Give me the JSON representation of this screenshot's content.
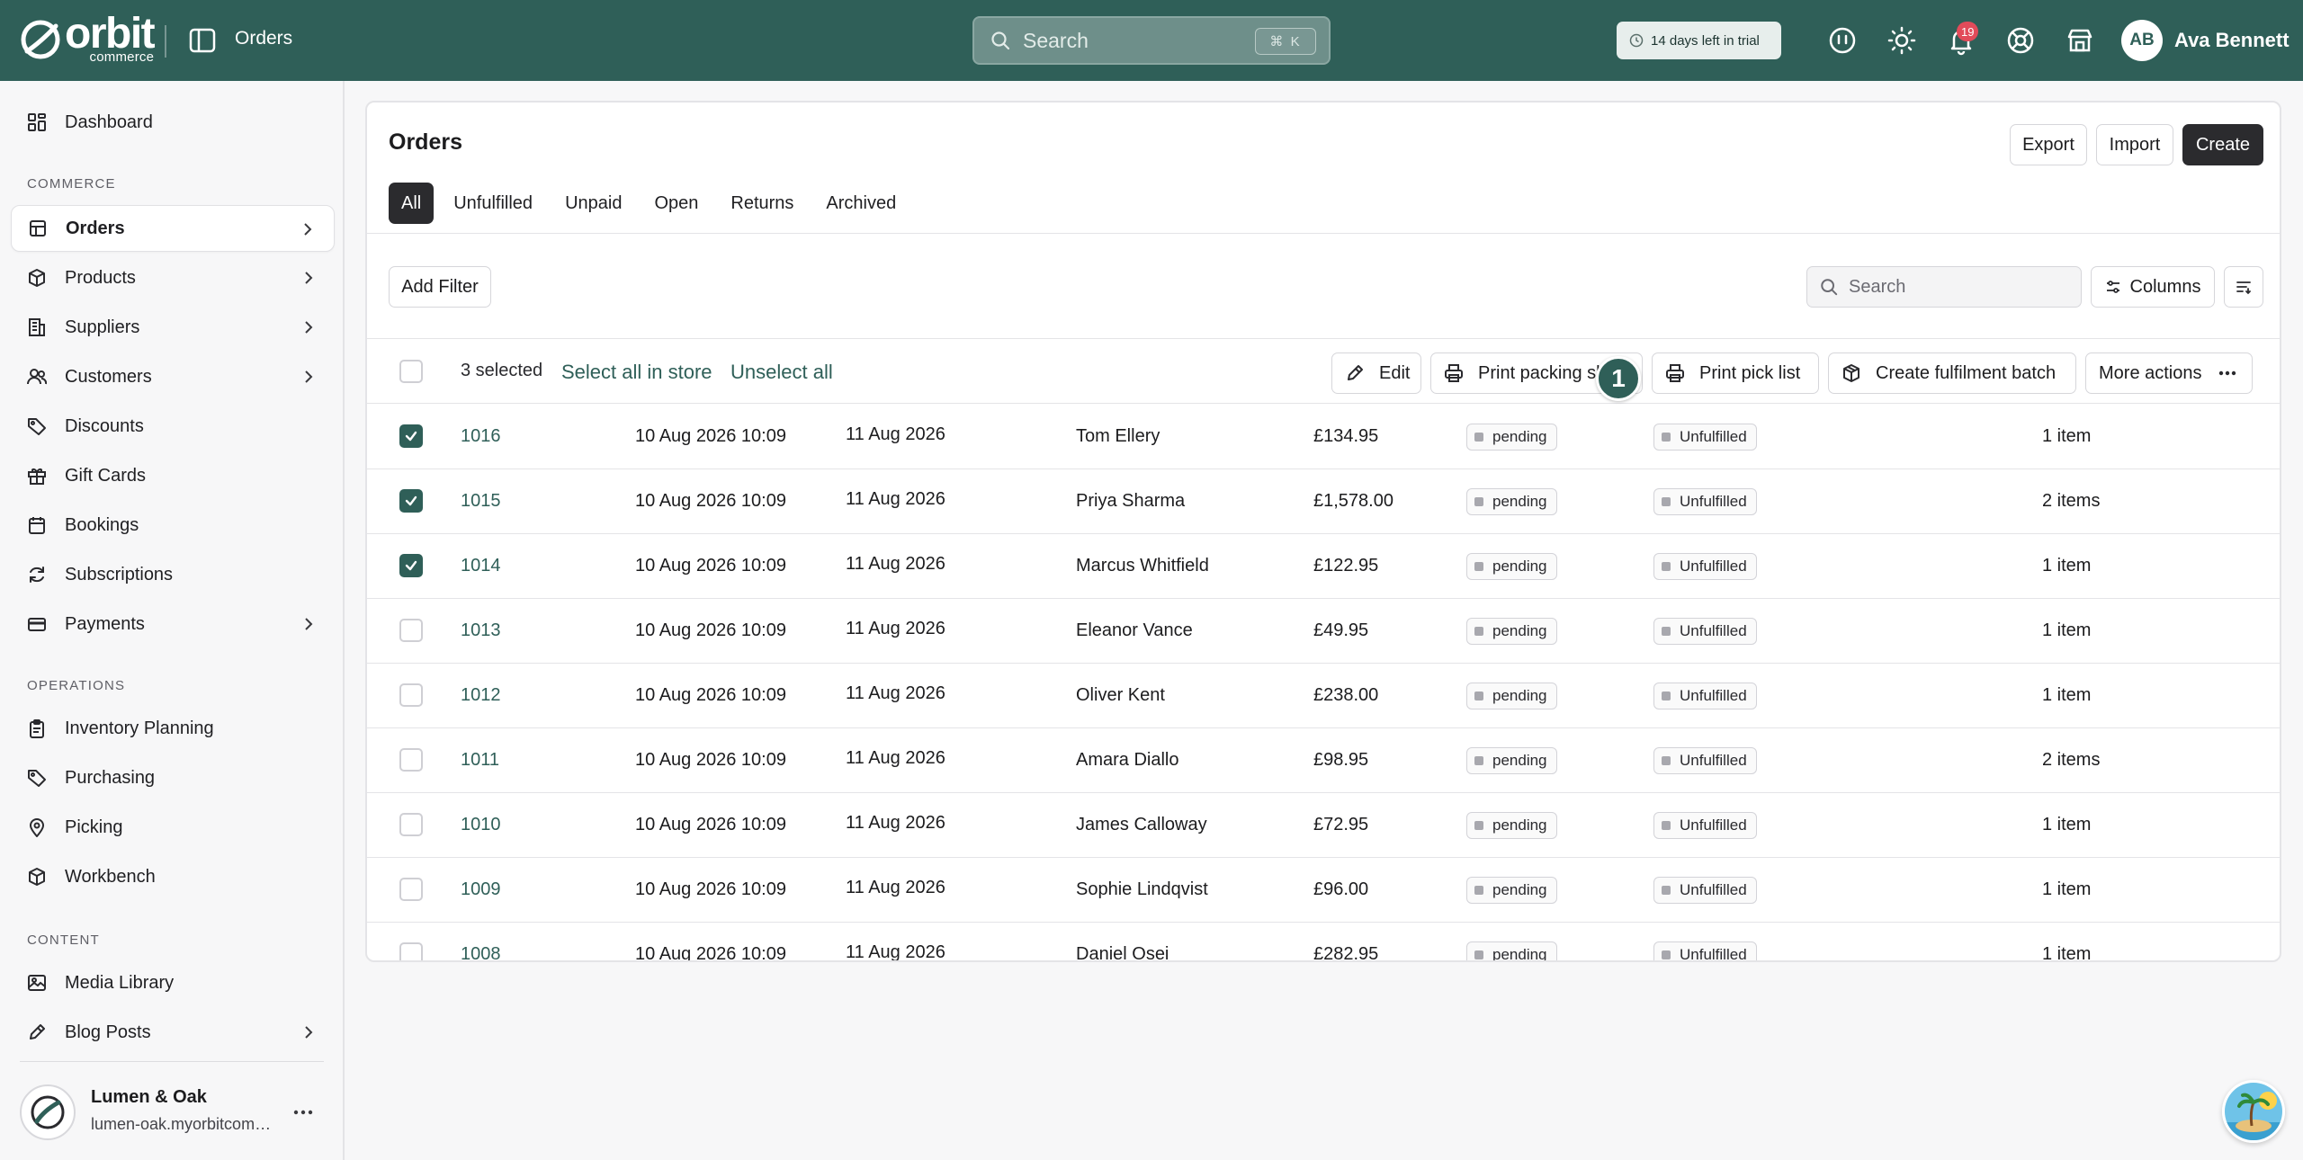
{
  "app": {
    "logo_word": "orbit",
    "logo_sub": "commerce",
    "top_title": "Orders",
    "search_placeholder": "Search",
    "search_shortcut": "⌘ K",
    "trial_text": "14 days left in trial",
    "notification_count": "19",
    "user_initials": "AB",
    "user_name": "Ava Bennett",
    "accent_color": "#2f5f58"
  },
  "sidebar": {
    "dashboard": "Dashboard",
    "commerce_label": "COMMERCE",
    "commerce_items": [
      {
        "label": "Orders",
        "icon": "orders-icon"
      },
      {
        "label": "Products",
        "icon": "box-icon"
      },
      {
        "label": "Suppliers",
        "icon": "building-icon"
      },
      {
        "label": "Customers",
        "icon": "users-icon"
      },
      {
        "label": "Discounts",
        "icon": "tag-icon"
      },
      {
        "label": "Gift Cards",
        "icon": "gift-icon"
      },
      {
        "label": "Bookings",
        "icon": "calendar-icon"
      },
      {
        "label": "Subscriptions",
        "icon": "refresh-icon"
      },
      {
        "label": "Payments",
        "icon": "card-icon"
      }
    ],
    "operations_label": "OPERATIONS",
    "operations_items": [
      {
        "label": "Inventory Planning",
        "icon": "clipboard-icon"
      },
      {
        "label": "Purchasing",
        "icon": "tag-icon"
      },
      {
        "label": "Picking",
        "icon": "pin-icon"
      },
      {
        "label": "Workbench",
        "icon": "box-icon"
      }
    ],
    "content_label": "CONTENT",
    "content_items": [
      {
        "label": "Media Library",
        "icon": "image-icon"
      },
      {
        "label": "Blog Posts",
        "icon": "pen-icon"
      }
    ],
    "store_name": "Lumen & Oak",
    "store_url": "lumen-oak.myorbitcommerce.com"
  },
  "page": {
    "title": "Orders",
    "export": "Export",
    "import": "Import",
    "create": "Create",
    "tabs": [
      "All",
      "Unfulfilled",
      "Unpaid",
      "Open",
      "Returns",
      "Archived"
    ],
    "add_filter": "Add Filter",
    "search_placeholder": "Search",
    "columns": "Columns"
  },
  "bulk": {
    "selected": "3 selected",
    "select_all": "Select all in store",
    "unselect_all": "Unselect all",
    "edit": "Edit",
    "print_packing": "Print packing slips",
    "step": "1",
    "print_pick": "Print pick list",
    "create_batch": "Create fulfilment batch",
    "more_actions": "More actions"
  },
  "orders": [
    {
      "id": "1016",
      "created": "10 Aug 2026 10:09",
      "date": "11 Aug 2026",
      "customer": "Tom Ellery",
      "total": "£134.95",
      "payment": "pending",
      "fulfilment": "Unfulfilled",
      "items": "1 item",
      "checked": true
    },
    {
      "id": "1015",
      "created": "10 Aug 2026 10:09",
      "date": "11 Aug 2026",
      "customer": "Priya Sharma",
      "total": "£1,578.00",
      "payment": "pending",
      "fulfilment": "Unfulfilled",
      "items": "2 items",
      "checked": true
    },
    {
      "id": "1014",
      "created": "10 Aug 2026 10:09",
      "date": "11 Aug 2026",
      "customer": "Marcus Whitfield",
      "total": "£122.95",
      "payment": "pending",
      "fulfilment": "Unfulfilled",
      "items": "1 item",
      "checked": true
    },
    {
      "id": "1013",
      "created": "10 Aug 2026 10:09",
      "date": "11 Aug 2026",
      "customer": "Eleanor Vance",
      "total": "£49.95",
      "payment": "pending",
      "fulfilment": "Unfulfilled",
      "items": "1 item",
      "checked": false
    },
    {
      "id": "1012",
      "created": "10 Aug 2026 10:09",
      "date": "11 Aug 2026",
      "customer": "Oliver Kent",
      "total": "£238.00",
      "payment": "pending",
      "fulfilment": "Unfulfilled",
      "items": "1 item",
      "checked": false
    },
    {
      "id": "1011",
      "created": "10 Aug 2026 10:09",
      "date": "11 Aug 2026",
      "customer": "Amara Diallo",
      "total": "£98.95",
      "payment": "pending",
      "fulfilment": "Unfulfilled",
      "items": "2 items",
      "checked": false
    },
    {
      "id": "1010",
      "created": "10 Aug 2026 10:09",
      "date": "11 Aug 2026",
      "customer": "James Calloway",
      "total": "£72.95",
      "payment": "pending",
      "fulfilment": "Unfulfilled",
      "items": "1 item",
      "checked": false
    },
    {
      "id": "1009",
      "created": "10 Aug 2026 10:09",
      "date": "11 Aug 2026",
      "customer": "Sophie Lindqvist",
      "total": "£96.00",
      "payment": "pending",
      "fulfilment": "Unfulfilled",
      "items": "1 item",
      "checked": false
    },
    {
      "id": "1008",
      "created": "10 Aug 2026 10:09",
      "date": "11 Aug 2026",
      "customer": "Daniel Osei",
      "total": "£282.95",
      "payment": "pending",
      "fulfilment": "Unfulfilled",
      "items": "1 item",
      "checked": false
    }
  ]
}
